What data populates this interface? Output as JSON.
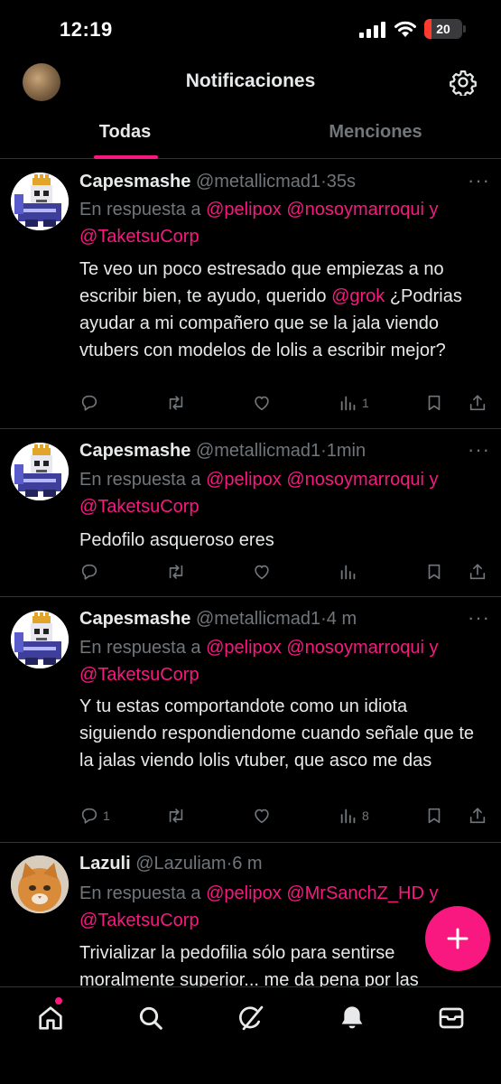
{
  "status_bar": {
    "time": "12:19",
    "battery": "20",
    "battery_level": 0.2
  },
  "header": {
    "title": "Notificaciones"
  },
  "tabs": [
    {
      "label": "Todas",
      "active": true
    },
    {
      "label": "Menciones",
      "active": false
    }
  ],
  "tweets": [
    {
      "name": "Capesmashe",
      "handle": "@metallicmad1",
      "time": "35s",
      "reply_prefix": "En respuesta a",
      "mentions": [
        "@pelipox",
        "@nosoymarroqui",
        "@TaketsuCorp"
      ],
      "reply_joiner": "y",
      "text_before": "Te veo un poco estresado que empiezas a no escribir bien, te ayudo, querido ",
      "text_mention": "@grok",
      "text_after": " ¿Podrias ayudar a mi compañero que se la jala viendo vtubers con modelos de lolis a escribir mejor?",
      "replies": "",
      "views": "1"
    },
    {
      "name": "Capesmashe",
      "handle": "@metallicmad1",
      "time": "1min",
      "reply_prefix": "En respuesta a",
      "mentions": [
        "@pelipox",
        "@nosoymarroqui",
        "@TaketsuCorp"
      ],
      "reply_joiner": "y",
      "text_before": "Pedofilo asqueroso eres",
      "text_mention": "",
      "text_after": "",
      "replies": "",
      "views": ""
    },
    {
      "name": "Capesmashe",
      "handle": "@metallicmad1",
      "time": "4 m",
      "reply_prefix": "En respuesta a",
      "mentions": [
        "@pelipox",
        "@nosoymarroqui",
        "@TaketsuCorp"
      ],
      "reply_joiner": "y",
      "text_before": "Y tu estas comportandote como un idiota siguiendo respondiendome cuando señale que te la jalas viendo lolis vtuber, que asco me das",
      "text_mention": "",
      "text_after": "",
      "replies": "1",
      "views": "8"
    },
    {
      "name": "Lazuli",
      "handle": "@Lazuliam",
      "time": "6 m",
      "reply_prefix": "En respuesta a",
      "mentions": [
        "@pelipox",
        "@MrSanchZ_HD",
        "@TaketsuCorp"
      ],
      "reply_joiner": "y",
      "text_before": "Trivializar la pedofilia sólo para sentirse moralmente superior... me da pena por las",
      "text_mention": "",
      "text_after": "",
      "replies": "",
      "views": ""
    }
  ],
  "separators": {
    "dot": "·"
  },
  "icons": {
    "header": [
      "avatar",
      "gear-icon"
    ],
    "actions": [
      "reply-icon",
      "retweet-icon",
      "like-icon",
      "views-icon",
      "bookmark-icon",
      "share-icon"
    ],
    "nav": [
      "home-icon",
      "search-icon",
      "grok-icon",
      "notifications-icon",
      "messages-icon"
    ],
    "fab": "plus-icon"
  },
  "colors": {
    "accent": "#f91880",
    "background": "#000000",
    "text": "#e7e9ea",
    "muted": "#71767b"
  }
}
